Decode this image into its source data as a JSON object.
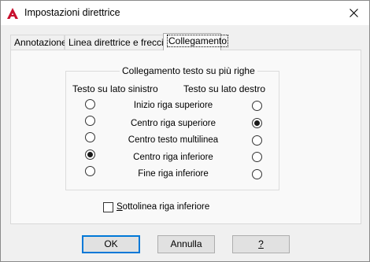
{
  "window": {
    "title": "Impostazioni direttrice",
    "icon": "autocad-a-icon",
    "close_glyph": "✕"
  },
  "tabs": [
    {
      "label": "Annotazione",
      "active": false
    },
    {
      "label": "Linea direttrice e freccia",
      "active": false
    },
    {
      "label": "Collegamento",
      "active": true
    }
  ],
  "attachment": {
    "group_title": "Collegamento testo su più righe",
    "left_header": "Testo su lato sinistro",
    "right_header": "Testo su lato destro",
    "rows": [
      {
        "label": "Inizio riga superiore",
        "left": false,
        "right": false
      },
      {
        "label": "Centro riga superiore",
        "left": false,
        "right": true
      },
      {
        "label": "Centro testo multilinea",
        "left": false,
        "right": false
      },
      {
        "label": "Centro riga inferiore",
        "left": true,
        "right": false
      },
      {
        "label": "Fine riga inferiore",
        "left": false,
        "right": false
      }
    ]
  },
  "underline_bottom_line": {
    "label_rest": "ottolinea riga inferiore",
    "mnemonic": "S",
    "checked": false
  },
  "buttons": {
    "ok": "OK",
    "cancel": "Annulla",
    "help": "?"
  },
  "colors": {
    "accent": "#0078d7",
    "autocad_red": "#c8102e"
  }
}
